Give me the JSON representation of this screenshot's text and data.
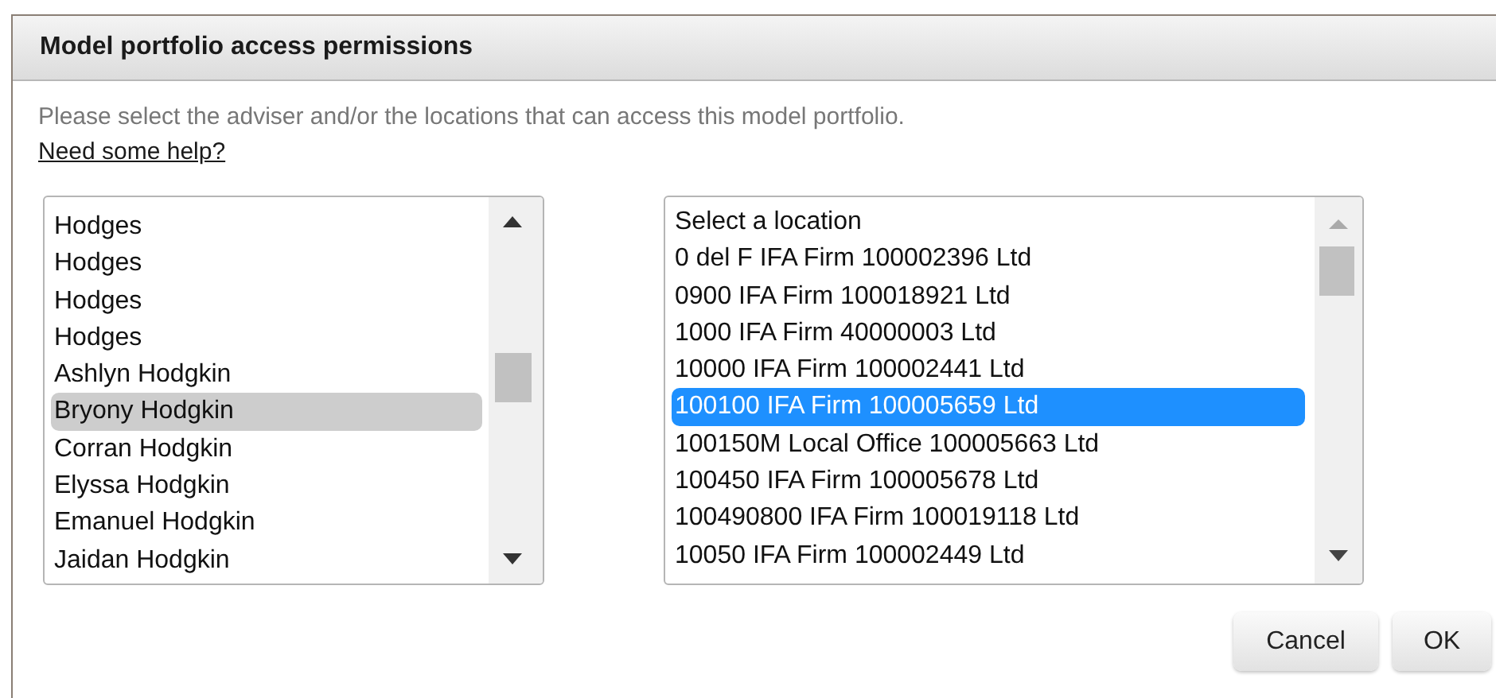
{
  "dialog": {
    "title": "Model portfolio access permissions",
    "instructions": "Please select the adviser and/or the locations that can access this model portfolio.",
    "help_link": "Need some help?",
    "advisers": [
      {
        "label": "Hodges",
        "selected": false
      },
      {
        "label": "Hodges",
        "selected": false
      },
      {
        "label": "Hodges",
        "selected": false
      },
      {
        "label": "Hodges",
        "selected": false
      },
      {
        "label": "Ashlyn Hodgkin",
        "selected": false
      },
      {
        "label": "Bryony Hodgkin",
        "selected": true
      },
      {
        "label": "Corran Hodgkin",
        "selected": false
      },
      {
        "label": "Elyssa Hodgkin",
        "selected": false
      },
      {
        "label": "Emanuel Hodgkin",
        "selected": false
      },
      {
        "label": "Jaidan Hodgkin",
        "selected": false
      }
    ],
    "locations": [
      {
        "label": "Select a location",
        "selected": false
      },
      {
        "label": "0 del F IFA Firm 100002396 Ltd",
        "selected": false
      },
      {
        "label": "0900 IFA Firm 100018921 Ltd",
        "selected": false
      },
      {
        "label": "1000 IFA Firm 40000003 Ltd",
        "selected": false
      },
      {
        "label": "10000 IFA Firm 100002441 Ltd",
        "selected": false
      },
      {
        "label": "100100 IFA Firm 100005659 Ltd",
        "selected": true
      },
      {
        "label": "100150M Local Office 100005663 Ltd",
        "selected": false
      },
      {
        "label": "100450 IFA Firm 100005678 Ltd",
        "selected": false
      },
      {
        "label": "100490800 IFA Firm 100019118 Ltd",
        "selected": false
      },
      {
        "label": "10050 IFA Firm 100002449 Ltd",
        "selected": false
      }
    ],
    "buttons": [
      "Cancel",
      "OK"
    ]
  }
}
